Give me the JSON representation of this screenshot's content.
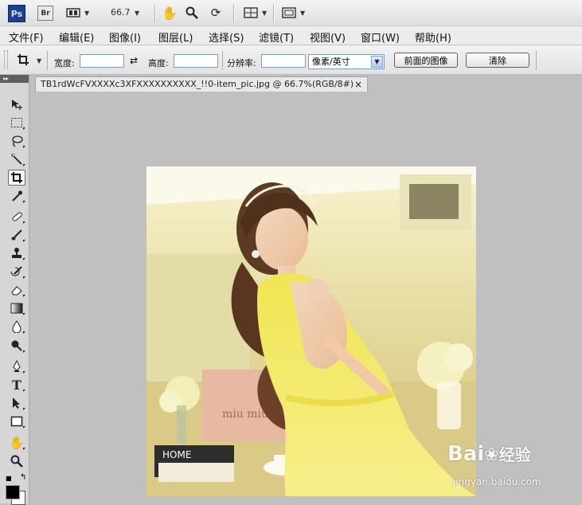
{
  "app": {
    "logo": "Ps",
    "bridge": "Br",
    "zoom": "66.7"
  },
  "menu": [
    "文件(F)",
    "编辑(E)",
    "图像(I)",
    "图层(L)",
    "选择(S)",
    "滤镜(T)",
    "视图(V)",
    "窗口(W)",
    "帮助(H)"
  ],
  "options": {
    "width_label": "宽度:",
    "height_label": "高度:",
    "resolution_label": "分辨率:",
    "unit_select": "像素/英寸",
    "front_image_button": "前面的图像",
    "clear_button": "清除"
  },
  "document": {
    "tab_title": "TB1rdWcFVXXXXc3XFXXXXXXXXXX_!!0-item_pic.jpg @ 66.7%(RGB/8#)",
    "close": "×"
  },
  "photo": {
    "bag_text": "miu miu",
    "book_text": "HOME"
  },
  "watermark": {
    "brand": "Bai",
    "brand_suffix": "经验",
    "url": "jingyan.baidu.com"
  },
  "tools": [
    "move-icon",
    "marquee-icon",
    "lasso-icon",
    "magic-wand-icon",
    "crop-icon",
    "eyedropper-icon",
    "healing-brush-icon",
    "brush-icon",
    "clone-stamp-icon",
    "history-brush-icon",
    "eraser-icon",
    "gradient-icon",
    "blur-icon",
    "dodge-icon",
    "pen-icon",
    "type-icon",
    "path-select-icon",
    "shape-icon",
    "hand-icon",
    "zoom-icon"
  ],
  "colors": {
    "foreground": "#000000",
    "background": "#ffffff",
    "canvas_bg": "#c0c0c0"
  }
}
